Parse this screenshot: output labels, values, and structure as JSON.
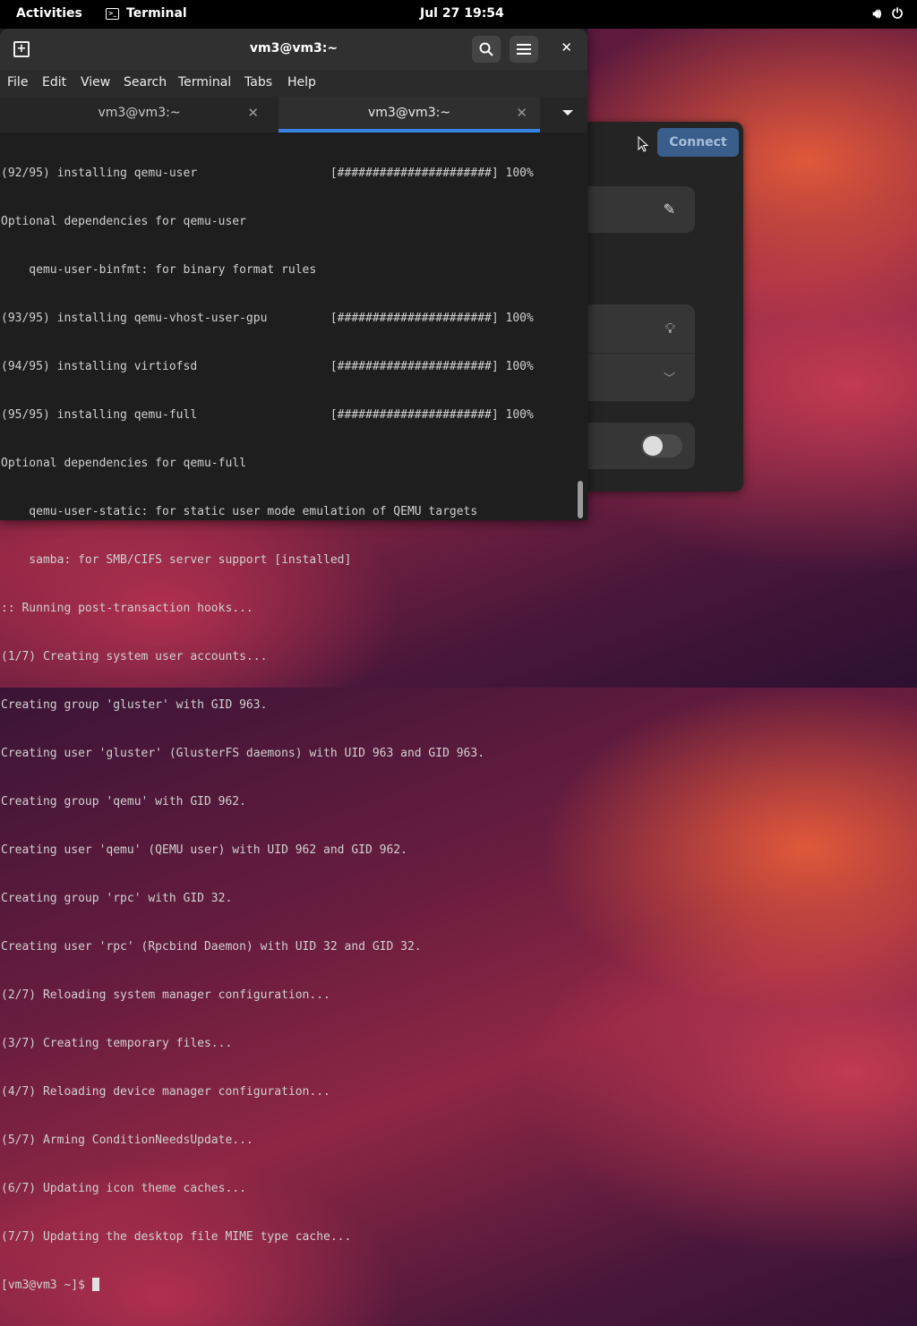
{
  "topbar": {
    "activities": "Activities",
    "app_name": "Terminal",
    "clock": "Jul 27  19:54"
  },
  "background_window": {
    "connect_label": "Connect"
  },
  "terminal": {
    "title": "vm3@vm3:~",
    "menu": [
      "File",
      "Edit",
      "View",
      "Search",
      "Terminal",
      "Tabs",
      "Help"
    ],
    "tabs": [
      {
        "label": "vm3@vm3:~",
        "active": false
      },
      {
        "label": "vm3@vm3:~",
        "active": true
      }
    ],
    "lines": [
      "(92/95) installing qemu-user                   [######################] 100%",
      "Optional dependencies for qemu-user",
      "    qemu-user-binfmt: for binary format rules",
      "(93/95) installing qemu-vhost-user-gpu         [######################] 100%",
      "(94/95) installing virtiofsd                   [######################] 100%",
      "(95/95) installing qemu-full                   [######################] 100%",
      "Optional dependencies for qemu-full",
      "    qemu-user-static: for static user mode emulation of QEMU targets",
      "    samba: for SMB/CIFS server support [installed]",
      ":: Running post-transaction hooks...",
      "(1/7) Creating system user accounts...",
      "Creating group 'gluster' with GID 963.",
      "Creating user 'gluster' (GlusterFS daemons) with UID 963 and GID 963.",
      "Creating group 'qemu' with GID 962.",
      "Creating user 'qemu' (QEMU user) with UID 962 and GID 962.",
      "Creating group 'rpc' with GID 32.",
      "Creating user 'rpc' (Rpcbind Daemon) with UID 32 and GID 32.",
      "(2/7) Reloading system manager configuration...",
      "(3/7) Creating temporary files...",
      "(4/7) Reloading device manager configuration...",
      "(5/7) Arming ConditionNeedsUpdate...",
      "(6/7) Updating icon theme caches...",
      "(7/7) Updating the desktop file MIME type cache..."
    ],
    "prompt": "[vm3@vm3 ~]$ "
  },
  "icons": {
    "volume": "speaker-icon",
    "power": "power-icon",
    "search": "search-icon",
    "menu": "hamburger-menu-icon",
    "close": "close-icon",
    "edit": "pencil-icon",
    "hint": "lightbulb-icon"
  }
}
